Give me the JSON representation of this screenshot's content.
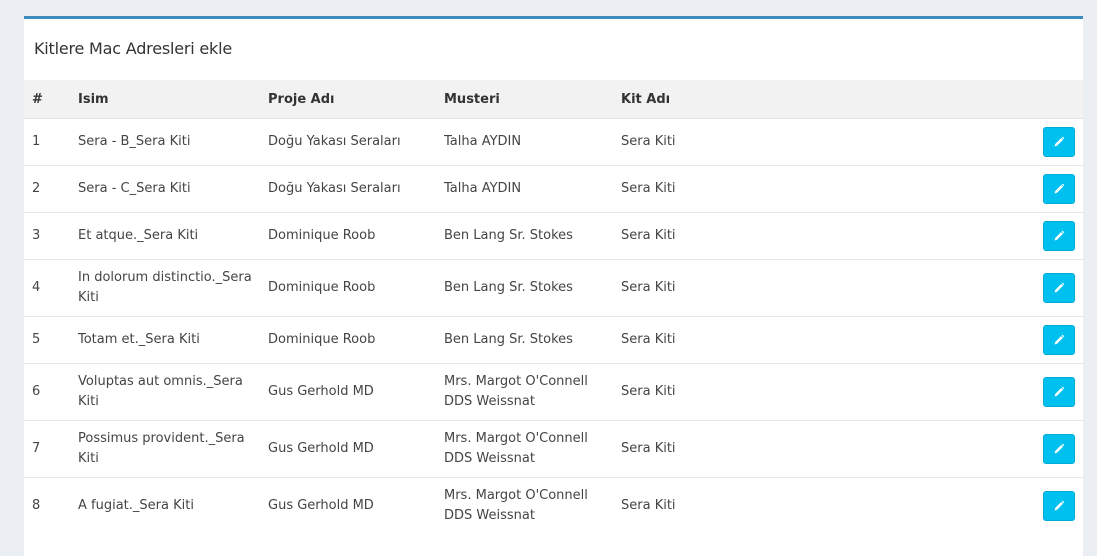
{
  "card": {
    "title": "Kitlere Mac Adresleri ekle"
  },
  "table": {
    "headers": {
      "num": "#",
      "isim": "Isim",
      "proje": "Proje Adı",
      "musteri": "Musteri",
      "kit": "Kit Adı"
    },
    "rows": [
      {
        "num": "1",
        "isim": "Sera - B_Sera Kiti",
        "proje": "Doğu Yakası Seraları",
        "musteri": "Talha AYDIN",
        "kit": "Sera Kiti"
      },
      {
        "num": "2",
        "isim": "Sera - C_Sera Kiti",
        "proje": "Doğu Yakası Seraları",
        "musteri": "Talha AYDIN",
        "kit": "Sera Kiti"
      },
      {
        "num": "3",
        "isim": "Et atque._Sera Kiti",
        "proje": "Dominique Roob",
        "musteri": "Ben Lang Sr. Stokes",
        "kit": "Sera Kiti"
      },
      {
        "num": "4",
        "isim": "In dolorum distinctio._Sera Kiti",
        "proje": "Dominique Roob",
        "musteri": "Ben Lang Sr. Stokes",
        "kit": "Sera Kiti"
      },
      {
        "num": "5",
        "isim": "Totam et._Sera Kiti",
        "proje": "Dominique Roob",
        "musteri": "Ben Lang Sr. Stokes",
        "kit": "Sera Kiti"
      },
      {
        "num": "6",
        "isim": "Voluptas aut omnis._Sera Kiti",
        "proje": "Gus Gerhold MD",
        "musteri": "Mrs. Margot O'Connell DDS Weissnat",
        "kit": "Sera Kiti"
      },
      {
        "num": "7",
        "isim": "Possimus provident._Sera Kiti",
        "proje": "Gus Gerhold MD",
        "musteri": "Mrs. Margot O'Connell DDS Weissnat",
        "kit": "Sera Kiti"
      },
      {
        "num": "8",
        "isim": "A fugiat._Sera Kiti",
        "proje": "Gus Gerhold MD",
        "musteri": "Mrs. Margot O'Connell DDS Weissnat",
        "kit": "Sera Kiti"
      }
    ],
    "row_action_icon": "pencil-icon"
  },
  "colors": {
    "card_top_border": "#3c8dbc",
    "edit_button": "#00c0ef",
    "page_background": "#ebeef3",
    "header_background": "#f2f2f2"
  }
}
